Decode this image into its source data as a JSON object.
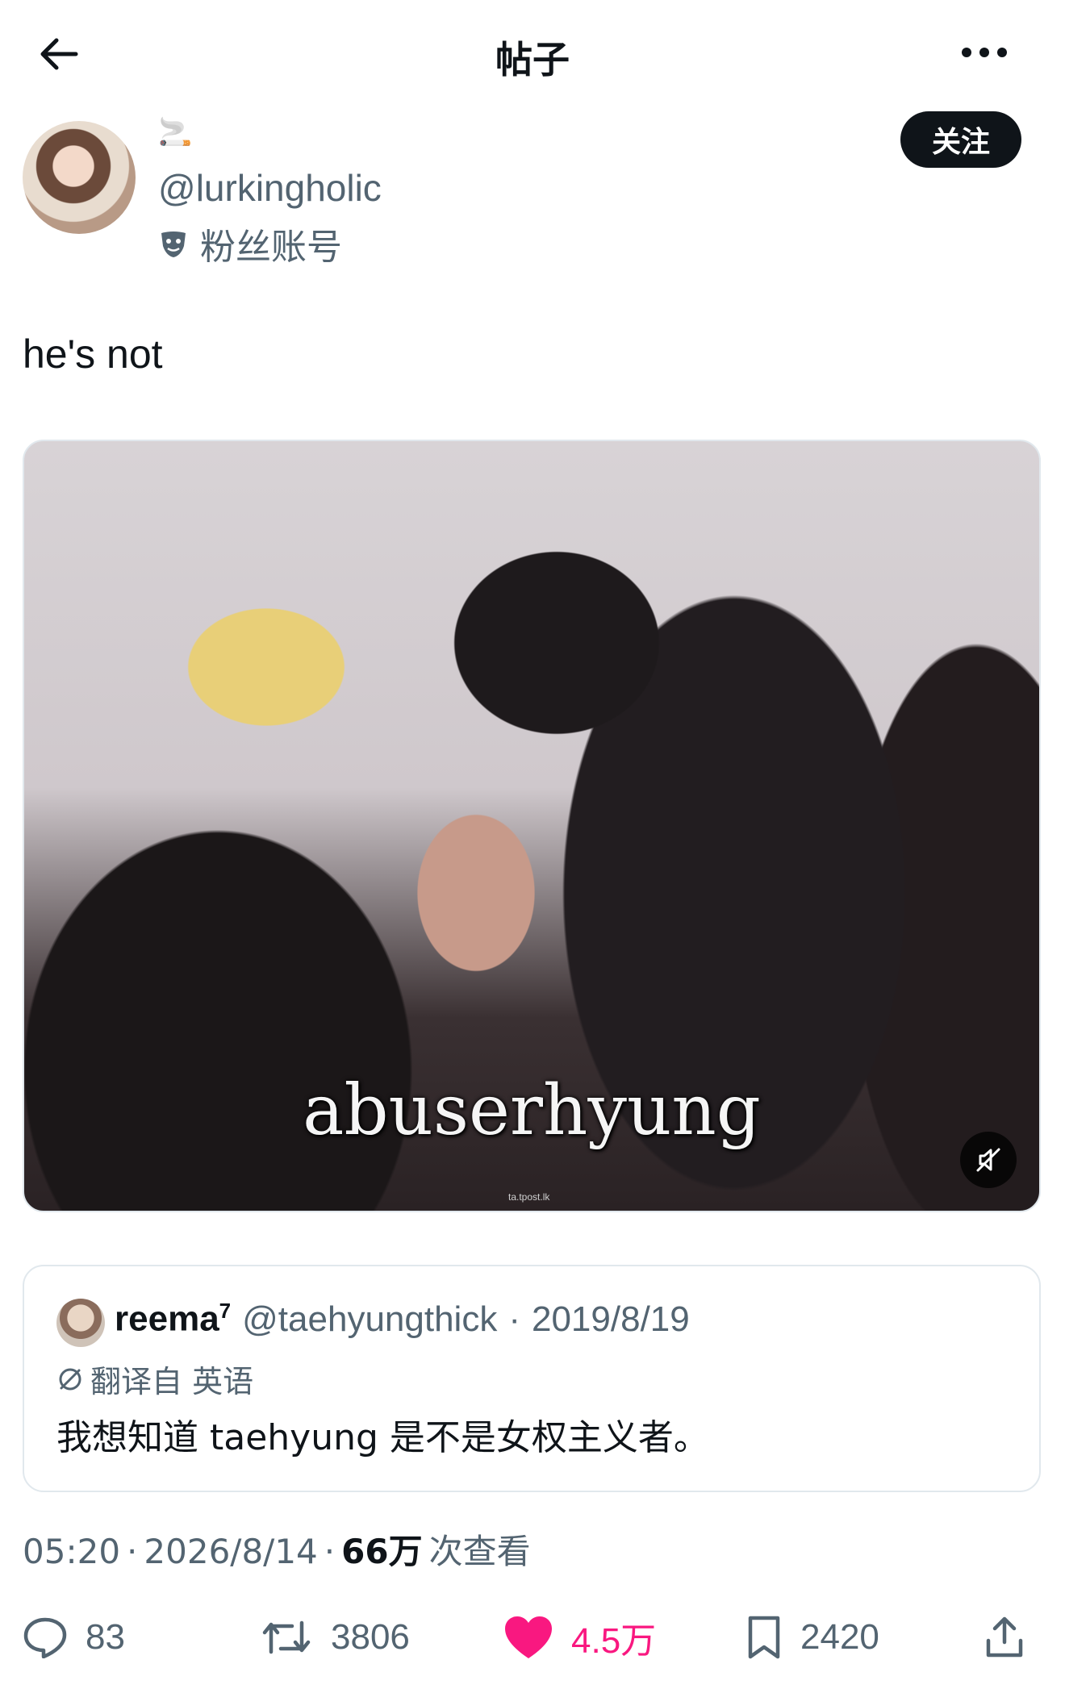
{
  "header": {
    "title": "帖子"
  },
  "author": {
    "display_name": "🚬",
    "handle": "@lurkingholic",
    "badge_label": "粉丝账号",
    "follow_label": "关注"
  },
  "tweet": {
    "text": "he's not"
  },
  "media": {
    "caption": "abuserhyung",
    "watermark": "ta.tpost.lk"
  },
  "quote": {
    "name": "reema",
    "name_superscript": "7",
    "handle": "@taehyungthick",
    "dot": "·",
    "date": "2019/8/19",
    "translated_label": "翻译自 英语",
    "text": "我想知道 taehyung 是不是女权主义者。"
  },
  "meta": {
    "time": "05:20",
    "dot1": "·",
    "date": "2026/8/14",
    "dot2": "·",
    "views": "66万",
    "views_label": "次查看"
  },
  "actions": {
    "replies": "83",
    "retweets": "3806",
    "likes": "4.5万",
    "bookmarks": "2420"
  },
  "colors": {
    "like": "#f91880",
    "secondary_text": "#536471",
    "primary_text": "#0f1419"
  }
}
